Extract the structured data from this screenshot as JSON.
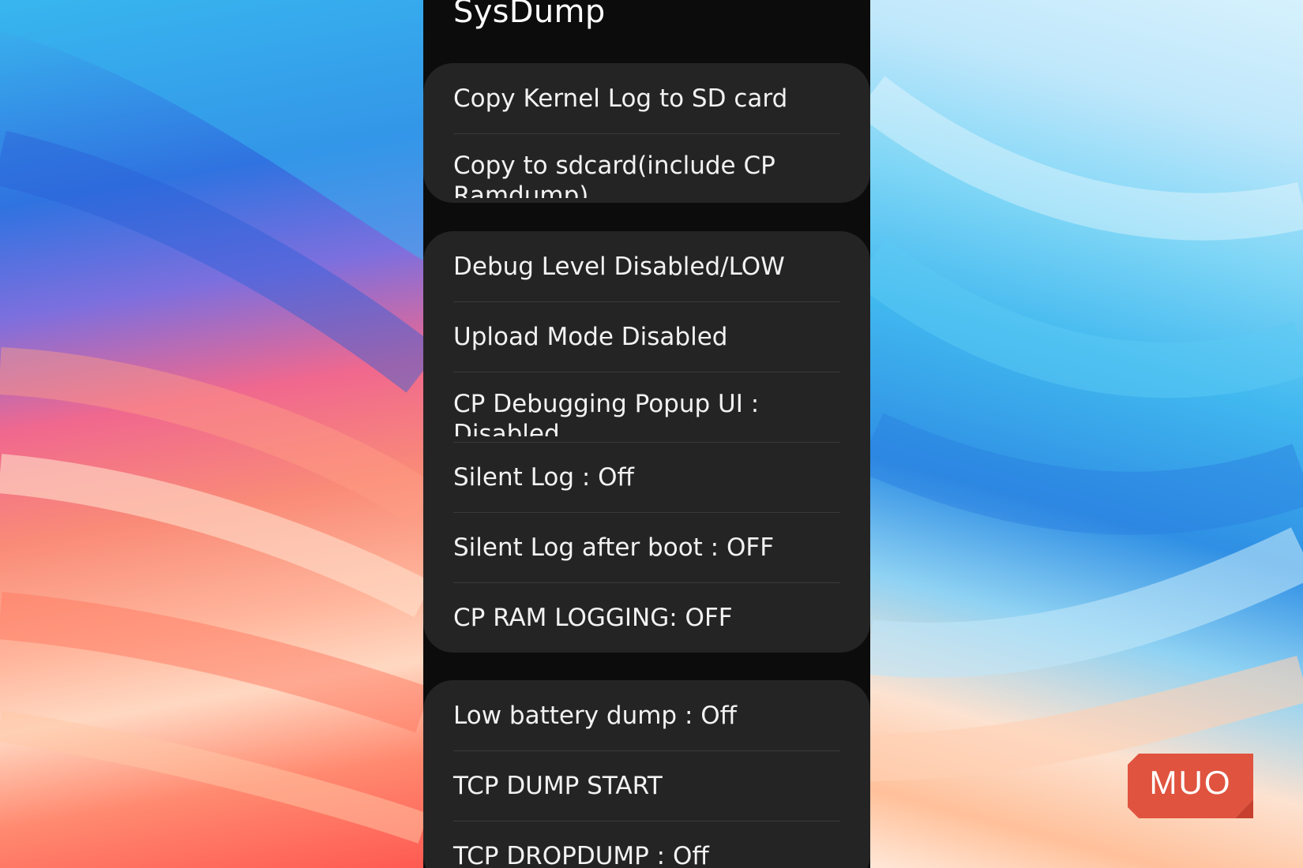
{
  "app": {
    "title": "SysDump"
  },
  "groups": [
    {
      "items": [
        {
          "label": "Copy Kernel Log to SD card"
        },
        {
          "label": "Copy to sdcard(include CP Ramdump)"
        }
      ]
    },
    {
      "items": [
        {
          "label": "Debug Level Disabled/LOW"
        },
        {
          "label": "Upload Mode Disabled"
        },
        {
          "label": "CP Debugging Popup UI : Disabled"
        },
        {
          "label": "Silent Log : Off"
        },
        {
          "label": "Silent Log after boot : OFF"
        },
        {
          "label": "CP RAM LOGGING: OFF"
        }
      ]
    },
    {
      "items": [
        {
          "label": "Low battery dump : Off"
        },
        {
          "label": "TCP DUMP START"
        },
        {
          "label": "TCP DROPDUMP : Off"
        }
      ]
    }
  ],
  "watermark": {
    "text": "MUO",
    "color": "#e0533f"
  }
}
